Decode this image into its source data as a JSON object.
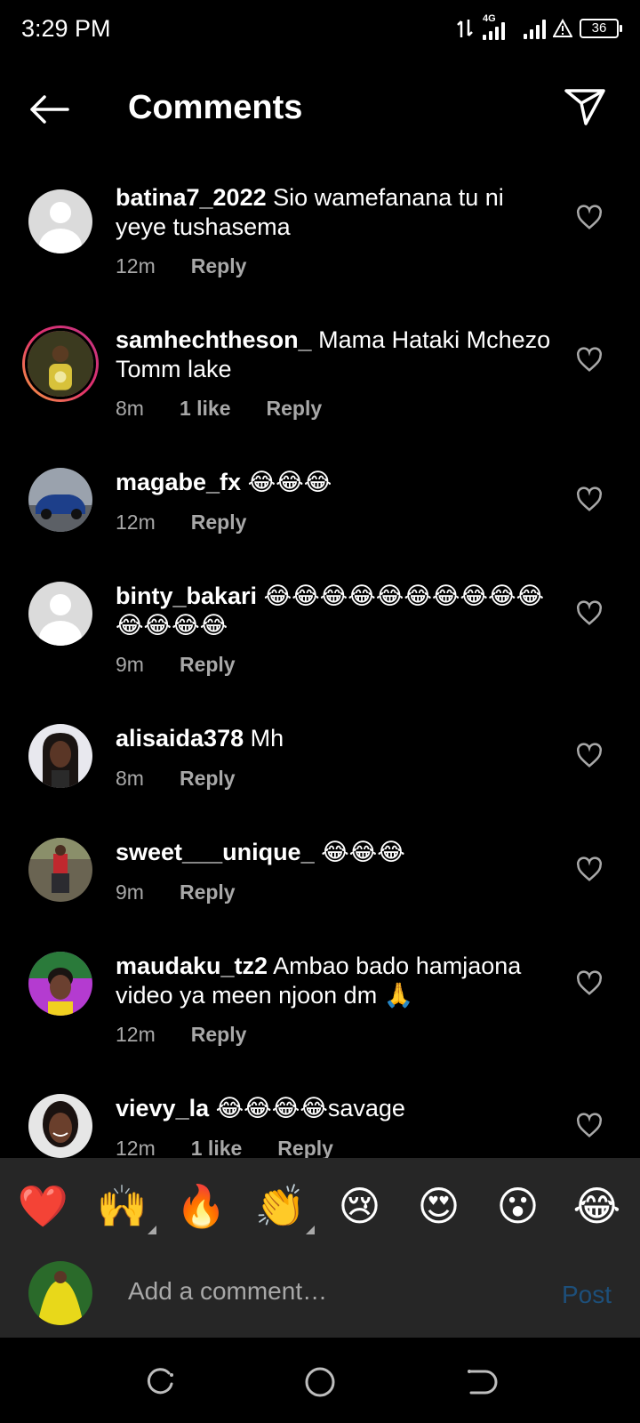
{
  "status_bar": {
    "time": "3:29 PM",
    "network": "4G",
    "battery": "36"
  },
  "header": {
    "title": "Comments",
    "back_icon": "arrow-left-icon",
    "share_icon": "paper-plane-icon"
  },
  "comments": [
    {
      "username": "batina7_2022",
      "text": "Sio wamefanana tu ni yeye tushasema",
      "time": "12m",
      "likes": "",
      "reply": "Reply"
    },
    {
      "username": "samhechtheson_",
      "text": "Mama Hataki Mchezo Tomm lake",
      "time": "8m",
      "likes": "1 like",
      "reply": "Reply"
    },
    {
      "username": "magabe_fx",
      "text": "😂😂😂",
      "time": "12m",
      "likes": "",
      "reply": "Reply"
    },
    {
      "username": "binty_bakari",
      "text": "😂😂😂😂😂😂😂😂😂😂😂😂😂😂",
      "time": "9m",
      "likes": "",
      "reply": "Reply"
    },
    {
      "username": "alisaida378",
      "text": "Mh",
      "time": "8m",
      "likes": "",
      "reply": "Reply"
    },
    {
      "username": "sweet___unique_",
      "text": "😂😂😂",
      "time": "9m",
      "likes": "",
      "reply": "Reply"
    },
    {
      "username": "maudaku_tz2",
      "text": "Ambao bado hamjaona video ya meen njoon dm 🙏",
      "time": "12m",
      "likes": "",
      "reply": "Reply"
    },
    {
      "username": "vievy_la",
      "text": "😂😂😂😂savage",
      "time": "12m",
      "likes": "1 like",
      "reply": "Reply"
    }
  ],
  "emoji_bar": [
    "❤️",
    "🙌",
    "🔥",
    "👏",
    "😢",
    "😍",
    "😮",
    "😂"
  ],
  "composer": {
    "placeholder": "Add a comment…",
    "post_label": "Post"
  },
  "colors": {
    "background": "#000000",
    "secondary_text": "#a8a8a8",
    "panel": "#262626",
    "post_disabled": "#1d4f7a"
  }
}
